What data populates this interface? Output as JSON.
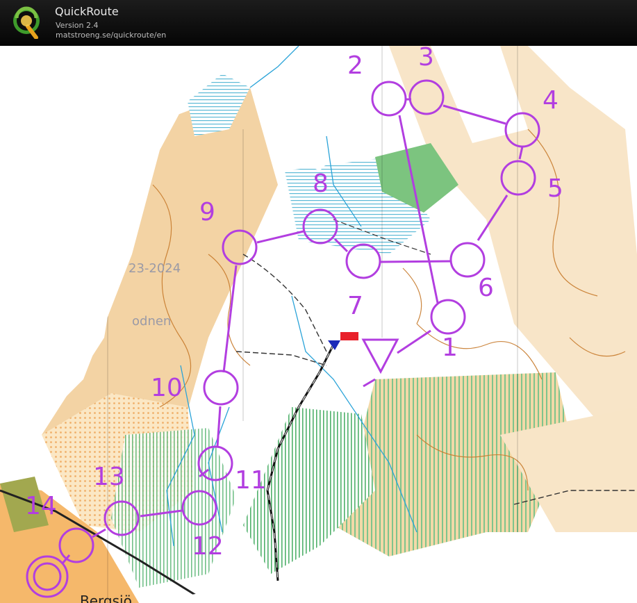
{
  "app": {
    "title": "QuickRoute",
    "version": "Version 2.4",
    "url": "matstroeng.se/quickroute/en",
    "logo_letter": "Q",
    "logo_icon": "quickroute-q-logo"
  },
  "map": {
    "course_color": "#b23ee0",
    "map_text": [
      "23-2024",
      "odnen",
      "Bergsjö"
    ],
    "start_label": "",
    "controls": [
      {
        "number": "1"
      },
      {
        "number": "2"
      },
      {
        "number": "3"
      },
      {
        "number": "4"
      },
      {
        "number": "5"
      },
      {
        "number": "6"
      },
      {
        "number": "7"
      },
      {
        "number": "8"
      },
      {
        "number": "9"
      },
      {
        "number": "10"
      },
      {
        "number": "11"
      },
      {
        "number": "12"
      },
      {
        "number": "13"
      },
      {
        "number": "14"
      }
    ]
  }
}
